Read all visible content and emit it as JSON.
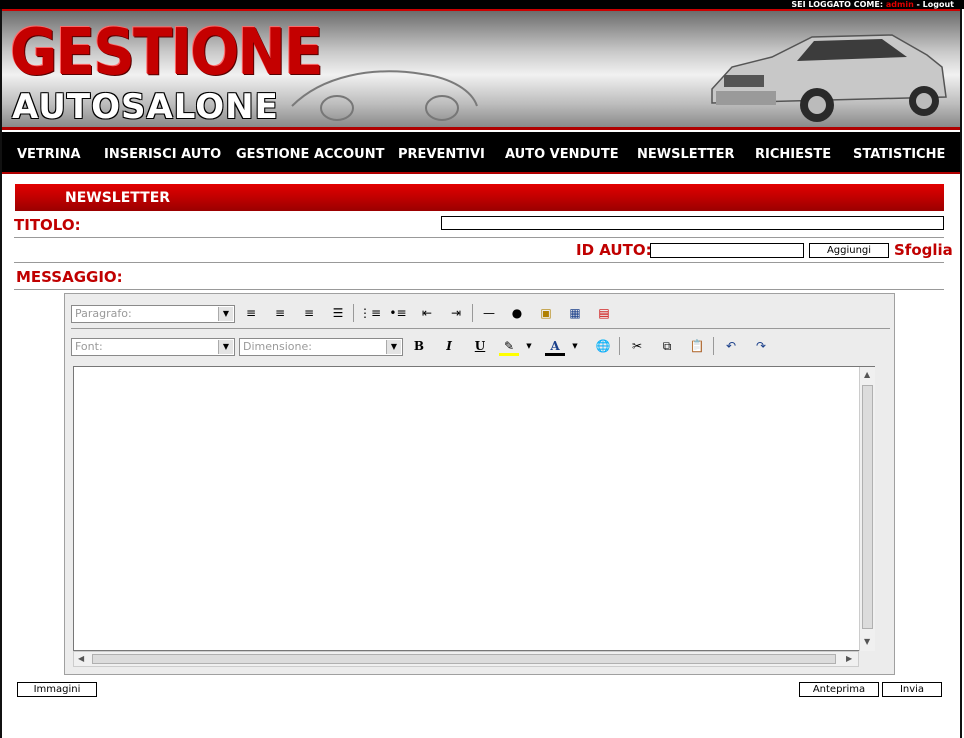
{
  "topbar": {
    "prefix": "SEI LOGGATO COME:",
    "user": "admin",
    "sep": " - ",
    "logout": "Logout"
  },
  "header": {
    "logo_line1": "GESTIONE",
    "logo_line2": "AUTOSALONE"
  },
  "nav": [
    "VETRINA",
    "INSERISCI AUTO",
    "GESTIONE ACCOUNT",
    "PREVENTIVI",
    "AUTO VENDUTE",
    "NEWSLETTER",
    "RICHIESTE",
    "STATISTICHE"
  ],
  "section": {
    "title": "NEWSLETTER"
  },
  "form": {
    "titolo_label": "TITOLO:",
    "titolo_value": "",
    "idauto_label": "ID AUTO:",
    "idauto_value": "",
    "aggiungi": "Aggiungi",
    "sfoglia": "Sfoglia",
    "messaggio_label": "MESSAGGIO:"
  },
  "editor": {
    "paragraph_placeholder": "Paragrafo:",
    "font_placeholder": "Font:",
    "size_placeholder": "Dimensione:",
    "icons_row1": [
      "align-left-icon",
      "align-center-icon",
      "align-right-icon",
      "align-justify-icon",
      "ordered-list-icon",
      "unordered-list-icon",
      "outdent-icon",
      "indent-icon",
      "horizontal-rule-icon",
      "sphere-icon",
      "image-icon",
      "table-icon",
      "chart-icon"
    ],
    "icons_row2": [
      "bold-icon",
      "italic-icon",
      "underline-icon",
      "highlight-icon",
      "font-color-icon",
      "link-icon",
      "cut-icon",
      "copy-icon",
      "paste-icon",
      "undo-icon",
      "redo-icon"
    ],
    "bold": "B",
    "italic": "I",
    "underline": "U",
    "font_color": "A"
  },
  "footer": {
    "immagini": "Immagini",
    "anteprima": "Anteprima",
    "invia": "Invia"
  },
  "colors": {
    "accent": "#c00000",
    "nav_bg": "#000000",
    "highlight": "#ffff00"
  }
}
